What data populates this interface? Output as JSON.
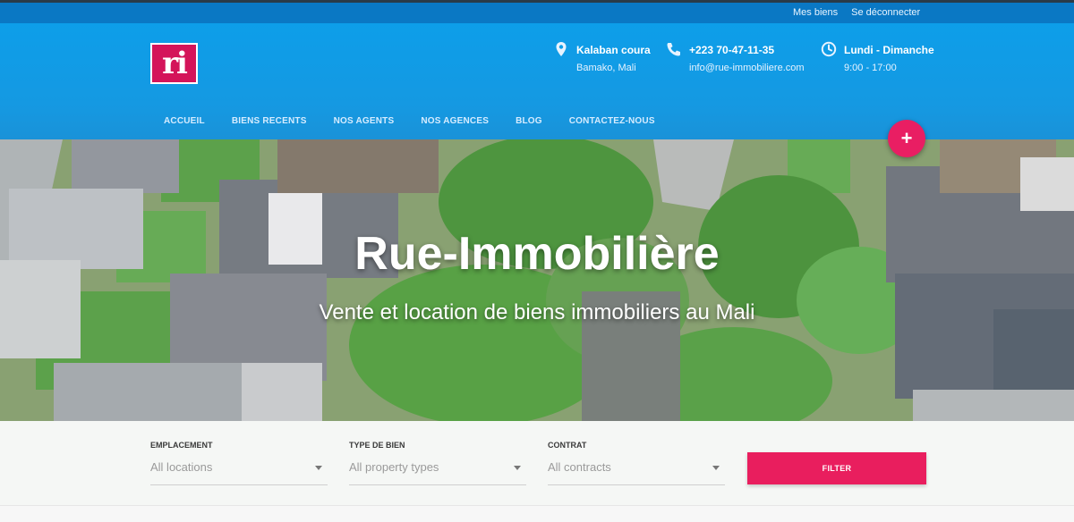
{
  "topbar": {
    "my_properties": "Mes biens",
    "logout": "Se déconnecter"
  },
  "logo": {
    "text": "ri"
  },
  "contact": {
    "location": {
      "icon": "map-pin-icon",
      "line1": "Kalaban coura",
      "line2": "Bamako, Mali"
    },
    "phone": {
      "icon": "phone-icon",
      "line1": "+223 70-47-11-35",
      "line2": "info@rue-immobiliere.com"
    },
    "hours": {
      "icon": "clock-icon",
      "line1": "Lundi - Dimanche",
      "line2": "9:00 - 17:00"
    }
  },
  "nav": [
    {
      "label": "ACCUEIL"
    },
    {
      "label": "BIENS RECENTS"
    },
    {
      "label": "NOS AGENTS"
    },
    {
      "label": "NOS AGENCES"
    },
    {
      "label": "BLOG"
    },
    {
      "label": "CONTACTEZ-NOUS"
    }
  ],
  "fab": {
    "label": "+"
  },
  "hero": {
    "title": "Rue-Immobilière",
    "subtitle": "Vente et location de biens immobiliers au Mali"
  },
  "filter": {
    "location": {
      "label": "EMPLACEMENT",
      "value": "All locations"
    },
    "type": {
      "label": "TYPE DE BIEN",
      "value": "All property types"
    },
    "contract": {
      "label": "CONTRAT",
      "value": "All contracts"
    },
    "button": "FILTER"
  },
  "colors": {
    "topbar": "#0a78c4",
    "header": "#0d9ee9",
    "accent": "#e91e63",
    "logo_bg": "#d4145a"
  }
}
